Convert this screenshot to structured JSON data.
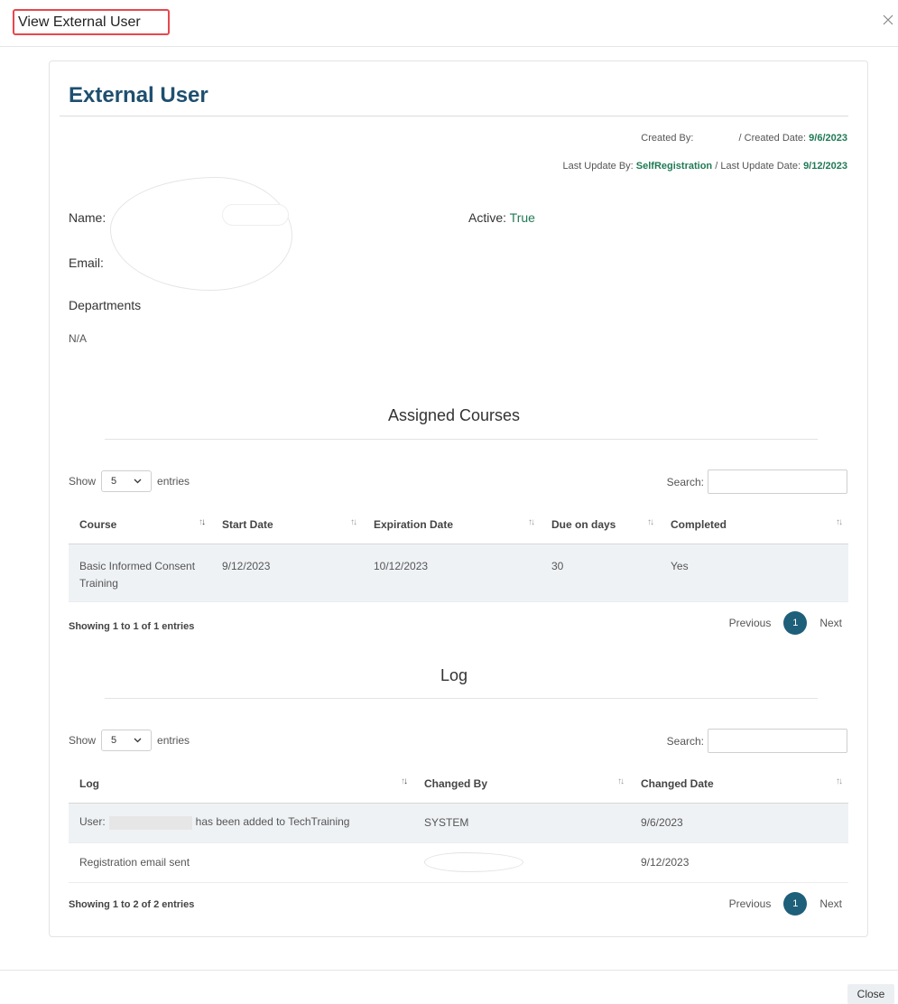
{
  "modal": {
    "title": "View External User",
    "close_label": "Close"
  },
  "card": {
    "title": "External User",
    "created_by_label": "Created By:",
    "created_date_label": "/ Created Date:",
    "created_date": "9/6/2023",
    "last_update_by_label": "Last Update By:",
    "last_update_by": "SelfRegistration",
    "last_update_date_label": "/ Last Update Date:",
    "last_update_date": "9/12/2023"
  },
  "fields": {
    "name_label": "Name:",
    "email_label": "Email:",
    "active_label": "Active:",
    "active_value": "True",
    "departments_label": "Departments",
    "departments_value": "N/A"
  },
  "courses": {
    "title": "Assigned Courses",
    "show_label": "Show",
    "entries_label": "entries",
    "page_size": "5",
    "search_label": "Search:",
    "columns": [
      "Course",
      "Start Date",
      "Expiration Date",
      "Due on days",
      "Completed"
    ],
    "rows": [
      [
        "Basic Informed Consent Training",
        "9/12/2023",
        "10/12/2023",
        "30",
        "Yes"
      ]
    ],
    "showing": "Showing 1 to 1 of 1 entries",
    "prev": "Previous",
    "page": "1",
    "next": "Next"
  },
  "log": {
    "title": "Log",
    "show_label": "Show",
    "entries_label": "entries",
    "page_size": "5",
    "search_label": "Search:",
    "columns": [
      "Log",
      "Changed By",
      "Changed Date"
    ],
    "rows": [
      {
        "pre": "User:",
        "post": "has been added to TechTraining",
        "by": "SYSTEM",
        "date": "9/6/2023"
      },
      {
        "text": "Registration email sent",
        "by": "",
        "date": "9/12/2023"
      }
    ],
    "showing": "Showing 1 to 2 of 2 entries",
    "prev": "Previous",
    "page": "1",
    "next": "Next"
  }
}
